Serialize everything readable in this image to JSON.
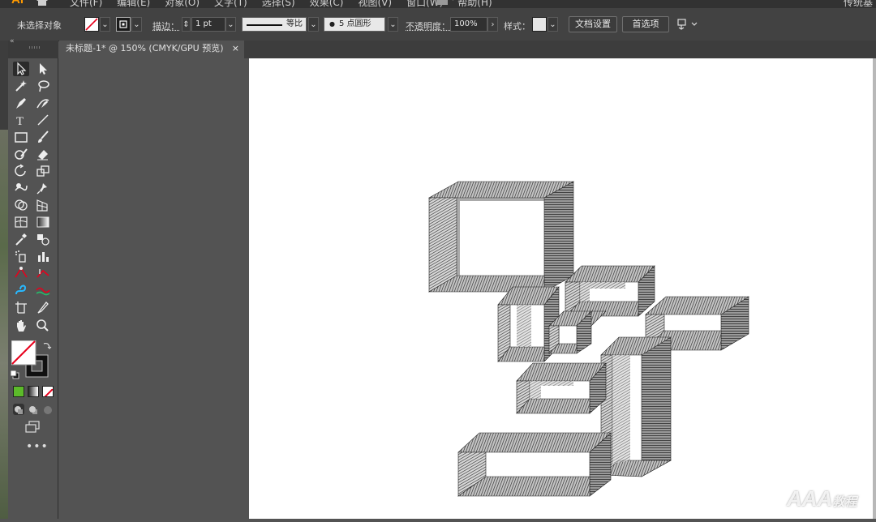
{
  "app": {
    "logo": "Ai",
    "menus": [
      "文件(F)",
      "编辑(E)",
      "对象(O)",
      "文字(T)",
      "选择(S)",
      "效果(C)",
      "视图(V)",
      "窗口(W)",
      "帮助(H)"
    ],
    "right_text": "传统基"
  },
  "control_bar": {
    "selection_status": "未选择对象",
    "stroke_label": "描边",
    "stroke_weight": "1 pt",
    "stroke_profile": "等比",
    "brush": "5 点圆形",
    "opacity_label": "不透明度",
    "opacity_value": "100%",
    "style_label": "样式",
    "doc_setup_button": "文档设置",
    "preferences_button": "首选项"
  },
  "document_tab": {
    "title": "未标题-1* @ 150% (CMYK/GPU 预览)",
    "close": "×"
  },
  "toolbar": {
    "tools": [
      "selection",
      "direct-selection",
      "magic-wand",
      "lasso",
      "pen",
      "curvature",
      "type",
      "line-segment",
      "rectangle",
      "paintbrush",
      "shaper",
      "eraser",
      "rotate",
      "scale",
      "warp",
      "free-transform",
      "shape-builder",
      "perspective-grid",
      "mesh",
      "gradient",
      "eyedropper",
      "blend",
      "symbol-sprayer",
      "column-graph",
      "artboard",
      "slice",
      "hand",
      "zoom"
    ],
    "more": "•••"
  },
  "colors": {
    "accent_logo": "#ff9a00",
    "ui_bg": "#535353",
    "toolbar_bg": "#535353",
    "canvas": "#ffffff"
  },
  "watermark": {
    "text": "AAA",
    "suffix": "教程"
  }
}
